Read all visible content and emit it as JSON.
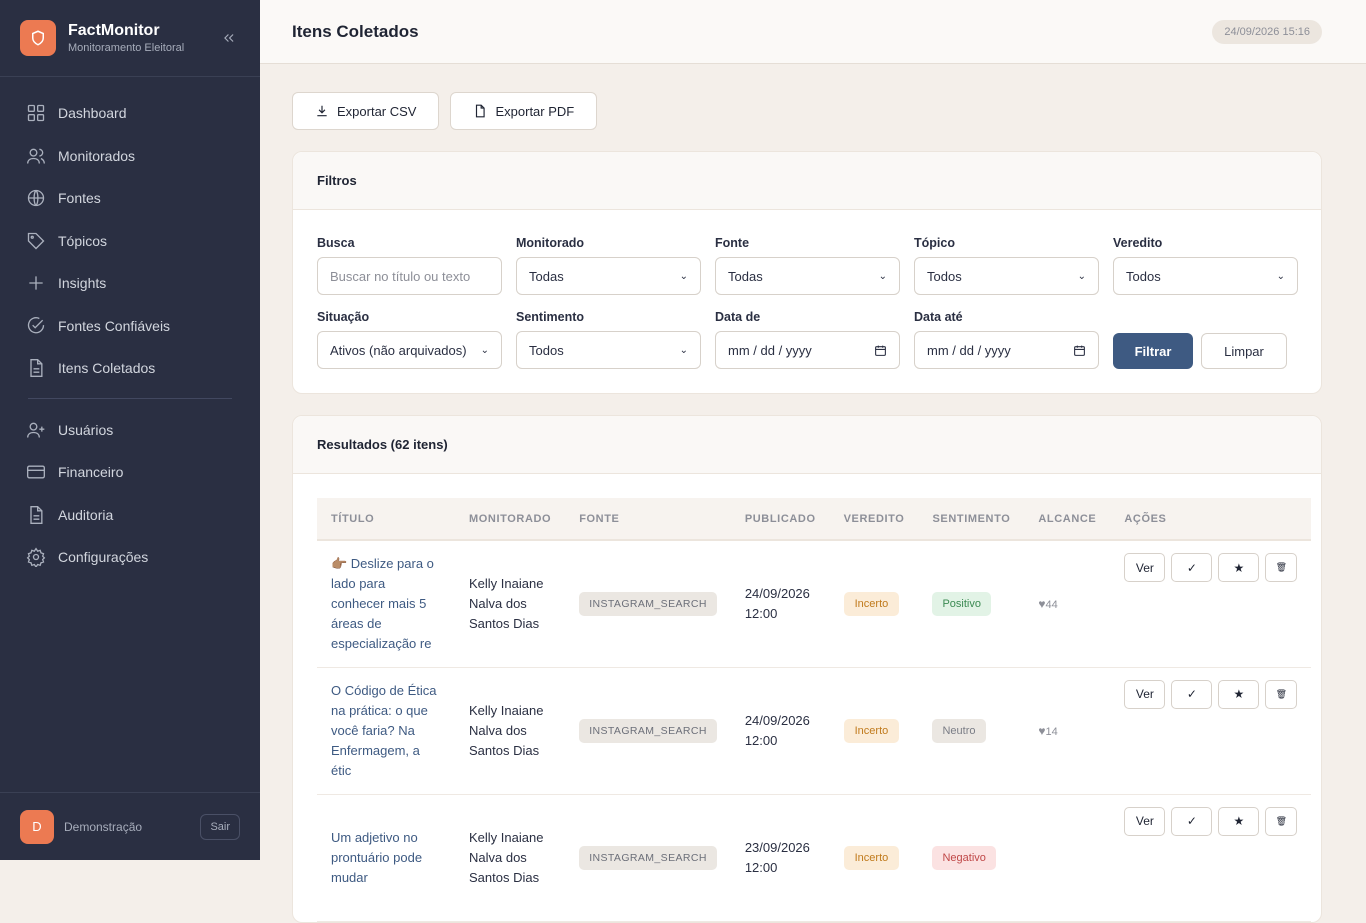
{
  "sidebar": {
    "brand_name": "FactMonitor",
    "brand_sub": "Monitoramento Eleitoral",
    "items": [
      {
        "label": "Dashboard",
        "icon": "grid-icon"
      },
      {
        "label": "Monitorados",
        "icon": "users-icon"
      },
      {
        "label": "Fontes",
        "icon": "globe-icon"
      },
      {
        "label": "Tópicos",
        "icon": "tag-icon"
      },
      {
        "label": "Insights",
        "icon": "plus-icon"
      },
      {
        "label": "Fontes Confiáveis",
        "icon": "check-circle-icon"
      },
      {
        "label": "Itens Coletados",
        "icon": "document-icon"
      },
      {
        "label": "Usuários",
        "icon": "user-plus-icon"
      },
      {
        "label": "Financeiro",
        "icon": "credit-card-icon"
      },
      {
        "label": "Auditoria",
        "icon": "document-icon"
      },
      {
        "label": "Configurações",
        "icon": "gear-icon"
      }
    ],
    "user": {
      "initial": "D",
      "name": "Demonstração",
      "logout_label": "Sair"
    }
  },
  "header": {
    "title": "Itens Coletados",
    "datetime": "24/09/2026 15:16"
  },
  "exports": {
    "csv_label": "Exportar CSV",
    "pdf_label": "Exportar PDF"
  },
  "filters": {
    "title": "Filtros",
    "busca": {
      "label": "Busca",
      "placeholder": "Buscar no título ou texto"
    },
    "monitorado": {
      "label": "Monitorado",
      "value": "Todas"
    },
    "fonte": {
      "label": "Fonte",
      "value": "Todas"
    },
    "topico": {
      "label": "Tópico",
      "value": "Todos"
    },
    "veredito": {
      "label": "Veredito",
      "value": "Todos"
    },
    "situacao": {
      "label": "Situação",
      "value": "Ativos (não arquivados)"
    },
    "sentimento": {
      "label": "Sentimento",
      "value": "Todos"
    },
    "data_de": {
      "label": "Data de",
      "placeholder": "mm / dd / yyyy"
    },
    "data_ate": {
      "label": "Data até",
      "placeholder": "mm / dd / yyyy"
    },
    "filter_label": "Filtrar",
    "clear_label": "Limpar"
  },
  "results": {
    "title": "Resultados (62 itens)",
    "columns": [
      "TÍTULO",
      "MONITORADO",
      "FONTE",
      "PUBLICADO",
      "VEREDITO",
      "SENTIMENTO",
      "ALCANCE",
      "AÇÕES"
    ],
    "rows": [
      {
        "title": "👉🏽 Deslize para o lado para conhecer mais 5 áreas de especialização re",
        "monitored": "Kelly Inaiane Nalva dos Santos Dias",
        "source": "INSTAGRAM_SEARCH",
        "published": "24/09/2026 12:00",
        "verdict": "Incerto",
        "sentiment": "Positivo",
        "reach": "44"
      },
      {
        "title": "O Código de Ética na prática: o que você faria? Na Enfermagem, a étic",
        "monitored": "Kelly Inaiane Nalva dos Santos Dias",
        "source": "INSTAGRAM_SEARCH",
        "published": "24/09/2026 12:00",
        "verdict": "Incerto",
        "sentiment": "Neutro",
        "reach": "14"
      },
      {
        "title": "Um adjetivo no prontuário pode mudar",
        "monitored": "Kelly Inaiane Nalva dos Santos Dias",
        "source": "INSTAGRAM_SEARCH",
        "published": "23/09/2026 12:00",
        "verdict": "Incerto",
        "sentiment": "Negativo",
        "reach": ""
      }
    ],
    "action_labels": {
      "view": "Ver",
      "approve": "✓",
      "star": "★",
      "archive": "🗑"
    }
  }
}
